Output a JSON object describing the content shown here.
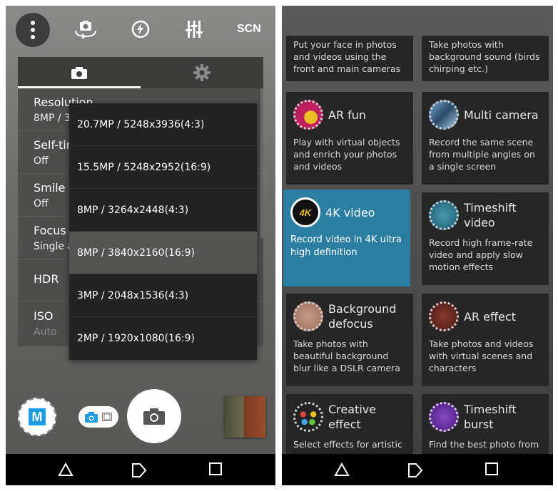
{
  "left": {
    "topbar": {
      "menu_icon": "more-vert-icon",
      "switch_camera_icon": "switch-camera-icon",
      "flash_icon": "flash-auto-icon",
      "adjust_icon": "sliders-icon",
      "scene_label": "SCN"
    },
    "panel": {
      "tabs": [
        {
          "name": "camera",
          "icon": "camera-icon",
          "selected": true
        },
        {
          "name": "settings",
          "icon": "gear-icon",
          "selected": false
        }
      ],
      "settings": [
        {
          "name": "Resolution",
          "value": "8MP / 3840x2160(16:9)"
        },
        {
          "name": "Self-timer",
          "value": "Off"
        },
        {
          "name": "Smile Shutter",
          "value": "Off"
        },
        {
          "name": "Focus mode",
          "value": "Single auto focus"
        },
        {
          "name": "HDR",
          "value": ""
        },
        {
          "name": "ISO",
          "value": "Auto"
        }
      ],
      "hdr_enabled": false
    },
    "dropdown": {
      "options": [
        "20.7MP / 5248x3936(4:3)",
        "15.5MP / 5248x2952(16:9)",
        "8MP / 3264x2448(4:3)",
        "8MP / 3840x2160(16:9)",
        "3MP / 2048x1536(4:3)",
        "2MP / 1920x1080(16:9)"
      ],
      "selected_index": 3
    },
    "bottom": {
      "mode_label": "M",
      "mode_accent": "#1e9be6"
    }
  },
  "right": {
    "cards": [
      {
        "title": "",
        "desc": "Put your face in photos and videos using the front and main cameras"
      },
      {
        "title": "",
        "desc": "Take photos with background sound (birds chirping etc.)"
      },
      {
        "title": "AR fun",
        "desc": "Play with virtual objects and enrich your photos and videos"
      },
      {
        "title": "Multi camera",
        "desc": "Record the same scene from multiple angles on a single screen"
      },
      {
        "title": "4K video",
        "desc": "Record video in 4K ultra high definition",
        "active": true
      },
      {
        "title": "Timeshift video",
        "desc": "Record high frame-rate video and apply slow motion effects"
      },
      {
        "title": "Background defocus",
        "desc": "Take photos with beautiful background blur like a DSLR camera"
      },
      {
        "title": "AR effect",
        "desc": "Take photos and videos with virtual scenes and characters"
      },
      {
        "title": "Creative effect",
        "desc": "Select effects for artistic"
      },
      {
        "title": "Timeshift burst",
        "desc": "Find the best photo from"
      }
    ],
    "active_color": "#2b7ea1",
    "icon_4k_label": "4K"
  },
  "navbar": {
    "back_icon": "back-triangle-icon",
    "home_icon": "home-icon",
    "recents_icon": "recents-square-icon"
  }
}
